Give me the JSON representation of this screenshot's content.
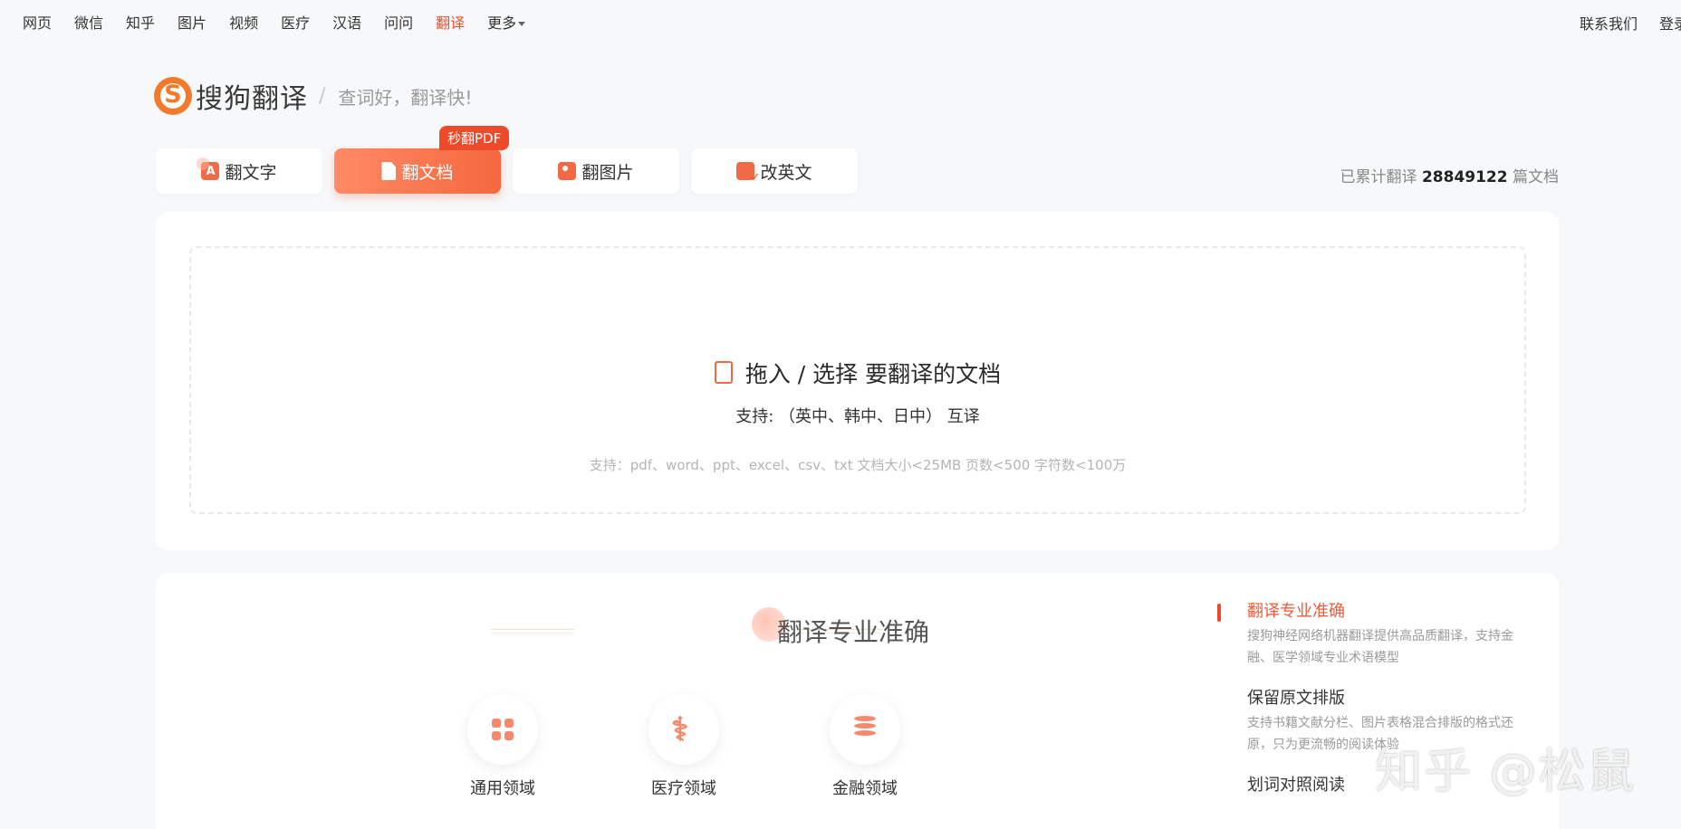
{
  "nav": {
    "links": [
      "网页",
      "微信",
      "知乎",
      "图片",
      "视频",
      "医疗",
      "汉语",
      "问问",
      "翻译",
      "更多"
    ],
    "active_index": 8,
    "contact": "联系我们",
    "login": "登录"
  },
  "logo": {
    "name": "搜狗翻译",
    "separator": "/",
    "slogan": "查词好，翻译快!"
  },
  "tabs": [
    {
      "label": "翻文字",
      "icon": "text-translate-icon"
    },
    {
      "label": "翻文档",
      "icon": "document-icon"
    },
    {
      "label": "翻图片",
      "icon": "image-icon"
    },
    {
      "label": "改英文",
      "icon": "edit-check-icon"
    }
  ],
  "active_tab": 1,
  "badge": "秒翻PDF",
  "counter": {
    "prefix": "已累计翻译",
    "count": "28849122",
    "suffix": "篇文档"
  },
  "upload": {
    "title": "拖入 / 选择 要翻译的文档",
    "languages": "支持: （英中、韩中、日中） 互译",
    "hint": "支持：pdf、word、ppt、excel、csv、txt    文档大小<25MB 页数<500 字符数<100万"
  },
  "section": {
    "title": "翻译专业准确",
    "domains": [
      {
        "label": "通用领域",
        "icon": "grid-icon"
      },
      {
        "label": "医疗领域",
        "icon": "medical-icon"
      },
      {
        "label": "金融领域",
        "icon": "coins-icon"
      }
    ]
  },
  "features": [
    {
      "title": "翻译专业准确",
      "desc": "搜狗神经网络机器翻译提供高品质翻译，支持金融、医学领域专业术语模型"
    },
    {
      "title": "保留原文排版",
      "desc": "支持书籍文献分栏、图片表格混合排版的格式还原，只为更流畅的阅读体验"
    },
    {
      "title": "划词对照阅读",
      "desc": ""
    }
  ],
  "watermark": "知乎 @松鼠",
  "colors": {
    "accent": "#ec4f2c",
    "tab_active_start": "#ff8a65",
    "tab_active_end": "#f5683f",
    "icon_soft": "#f6886c"
  }
}
